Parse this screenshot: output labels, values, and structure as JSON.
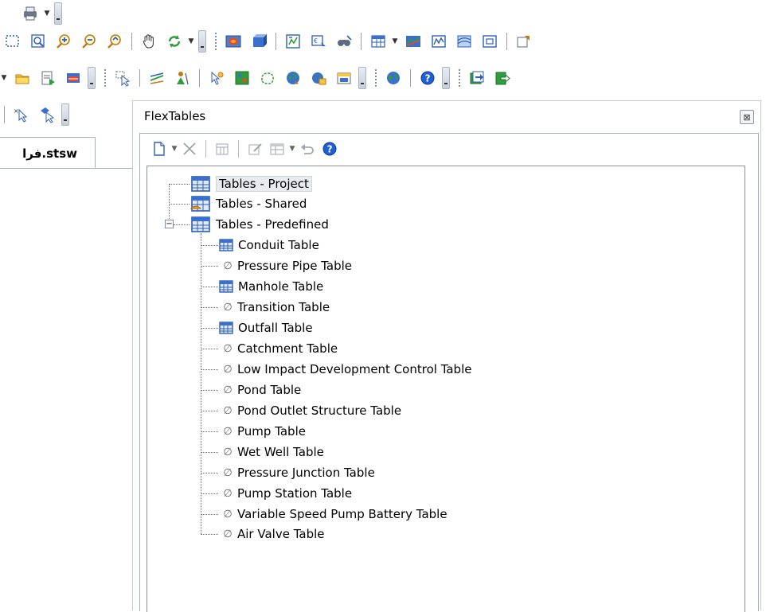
{
  "toolbars": {
    "row1": [
      "printer-icon"
    ],
    "row2": [
      "select-window-icon",
      "zoom-window-icon",
      "zoom-in-icon",
      "zoom-out-icon",
      "zoom-previous-icon",
      "pan-hand-icon",
      "refresh-icon",
      "render-icon",
      "3d-view-icon",
      "compute-icon",
      "locate-icon",
      "binoculars-icon",
      "table-icon",
      "profile-icon",
      "graph-icon",
      "contours-icon",
      "frame-icon",
      "properties-icon"
    ],
    "row3": [
      "open-folder-icon",
      "report-icon",
      "table-grid-icon",
      "select-arrow-icon",
      "network-navigator-icon",
      "surveyor-icon",
      "layout-tool-icon",
      "scenario-icon",
      "catchment-icon",
      "globe-icon",
      "gis-icon",
      "database-icon",
      "earth-icon",
      "help-icon",
      "export-icon",
      "exit-icon"
    ],
    "row4": [
      "select-tool-icon",
      "selection-tool-icon"
    ]
  },
  "document_tab": {
    "label": "فرا.stsw"
  },
  "panel": {
    "title": "FlexTables",
    "close_glyph": "⊠",
    "toolbar": [
      "new-table-icon",
      "delete-icon",
      "duplicate-icon",
      "edit-icon",
      "table-options-icon",
      "undo-icon",
      "help-icon"
    ]
  },
  "tree": {
    "roots": [
      {
        "label": "Tables - Project",
        "kind": "folder-project"
      },
      {
        "label": "Tables - Shared",
        "kind": "folder-shared"
      },
      {
        "label": "Tables - Predefined",
        "kind": "folder-predefined",
        "expanded": true
      }
    ],
    "items": [
      {
        "label": "Conduit Table",
        "has_icon": true
      },
      {
        "label": "Pressure Pipe Table",
        "has_icon": false
      },
      {
        "label": "Manhole Table",
        "has_icon": true
      },
      {
        "label": "Transition Table",
        "has_icon": false
      },
      {
        "label": "Outfall Table",
        "has_icon": true
      },
      {
        "label": "Catchment Table",
        "has_icon": false
      },
      {
        "label": "Low Impact Development Control Table",
        "has_icon": false
      },
      {
        "label": "Pond Table",
        "has_icon": false
      },
      {
        "label": "Pond Outlet Structure Table",
        "has_icon": false
      },
      {
        "label": "Pump Table",
        "has_icon": false
      },
      {
        "label": "Wet Well Table",
        "has_icon": false
      },
      {
        "label": "Pressure Junction Table",
        "has_icon": false
      },
      {
        "label": "Pump Station Table",
        "has_icon": false
      },
      {
        "label": "Variable Speed Pump Battery Table",
        "has_icon": false
      },
      {
        "label": "Air Valve Table",
        "has_icon": false
      }
    ],
    "empty_glyph": "∅",
    "expander_glyph": "−"
  },
  "colors": {
    "accent_blue": "#2f5fb3",
    "table_icon_blue": "#3a6fd0",
    "help_blue": "#1f5fd6"
  }
}
